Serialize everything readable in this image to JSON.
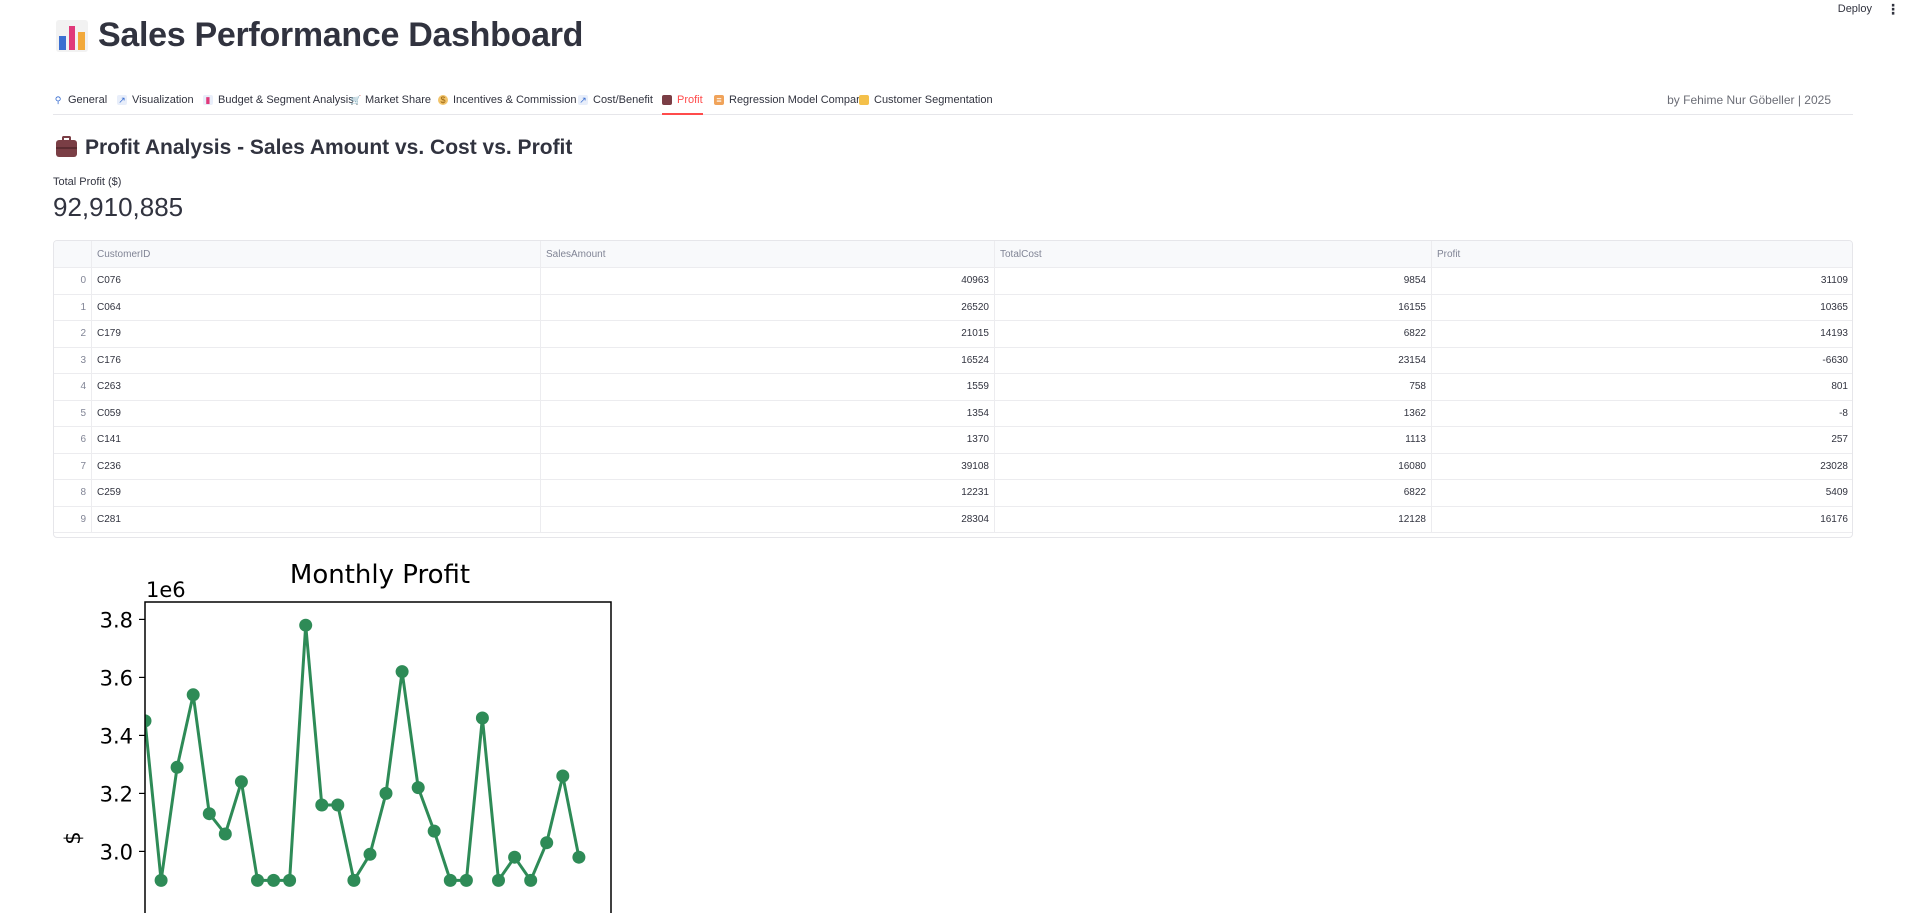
{
  "topbar": {
    "deploy": "Deploy",
    "menu": "⋮"
  },
  "header": {
    "title": "Sales Performance Dashboard",
    "icon": "bar-chart-icon"
  },
  "tabs": [
    {
      "label": "General",
      "icon": "magnifier-icon",
      "active": false
    },
    {
      "label": "Visualization",
      "icon": "chart-increasing-icon",
      "active": false
    },
    {
      "label": "Budget & Segment Analysis",
      "icon": "bar-chart-icon",
      "active": false
    },
    {
      "label": "Market Share",
      "icon": "cart-icon",
      "active": false
    },
    {
      "label": "Incentives & Commission",
      "icon": "money-bag-icon",
      "active": false
    },
    {
      "label": "Cost/Benefit",
      "icon": "chart-increasing-icon",
      "active": false
    },
    {
      "label": "Profit",
      "icon": "briefcase-icon",
      "active": true
    },
    {
      "label": "Regression Model Compare",
      "icon": "clipboard-icon",
      "active": false
    },
    {
      "label": "Customer Segmentation",
      "icon": "folder-icon",
      "active": false
    }
  ],
  "byline": "by Fehime Nur Göbeller | 2025",
  "section": {
    "title": "Profit Analysis - Sales Amount vs. Cost vs. Profit",
    "icon": "briefcase-icon"
  },
  "metric": {
    "label": "Total Profit ($)",
    "value": "92,910,885"
  },
  "table": {
    "columns": [
      "",
      "CustomerID",
      "SalesAmount",
      "TotalCost",
      "Profit"
    ],
    "rows": [
      [
        "0",
        "C076",
        "40963",
        "9854",
        "31109"
      ],
      [
        "1",
        "C064",
        "26520",
        "16155",
        "10365"
      ],
      [
        "2",
        "C179",
        "21015",
        "6822",
        "14193"
      ],
      [
        "3",
        "C176",
        "16524",
        "23154",
        "-6630"
      ],
      [
        "4",
        "C263",
        "1559",
        "758",
        "801"
      ],
      [
        "5",
        "C059",
        "1354",
        "1362",
        "-8"
      ],
      [
        "6",
        "C141",
        "1370",
        "1113",
        "257"
      ],
      [
        "7",
        "C236",
        "39108",
        "16080",
        "23028"
      ],
      [
        "8",
        "C259",
        "12231",
        "6822",
        "5409"
      ],
      [
        "9",
        "C281",
        "28304",
        "12128",
        "16176"
      ]
    ]
  },
  "chart_data": {
    "type": "line",
    "title": "Monthly Profit",
    "ylabel": "$",
    "xlabel": "",
    "y_multiplier_label": "1e6",
    "yticks": [
      "3.0",
      "3.2",
      "3.4",
      "3.6",
      "3.8"
    ],
    "ylim": [
      2.95,
      3.86
    ],
    "y_scale": 1000000,
    "x_count": 30,
    "series": [
      {
        "color": "#2e8b57",
        "values": [
          3.45,
          2.9,
          3.29,
          3.54,
          3.13,
          3.06,
          3.24,
          2.9,
          2.9,
          2.9,
          3.78,
          3.16,
          3.16,
          2.9,
          2.99,
          3.2,
          3.62,
          3.22,
          3.07,
          2.9,
          2.9,
          3.46,
          2.9,
          2.98,
          2.9,
          3.03,
          3.26,
          2.98
        ]
      }
    ]
  }
}
